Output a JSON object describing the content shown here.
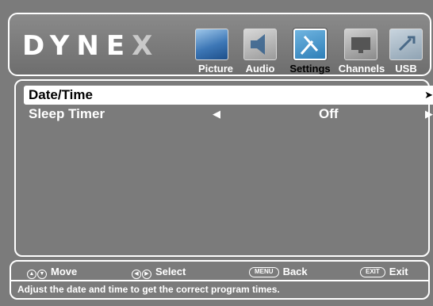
{
  "brand": {
    "logo_main": "DYNE",
    "logo_last": "X"
  },
  "tabs": [
    {
      "label": "Picture",
      "icon": "picture-icon",
      "active": false
    },
    {
      "label": "Audio",
      "icon": "audio-icon",
      "active": false
    },
    {
      "label": "Settings",
      "icon": "settings-icon",
      "active": true
    },
    {
      "label": "Channels",
      "icon": "channels-icon",
      "active": false
    },
    {
      "label": "USB",
      "icon": "usb-icon",
      "active": false
    }
  ],
  "menu": {
    "items": [
      {
        "label": "Date/Time",
        "value": "",
        "left_arrow": "",
        "right_arrow": "➤",
        "selected": true
      },
      {
        "label": "Sleep Timer",
        "value": "Off",
        "left_arrow": "◀",
        "right_arrow": "▶",
        "selected": false
      }
    ]
  },
  "footer": {
    "hints": [
      {
        "keys": [
          "▲",
          "▼"
        ],
        "label": "Move",
        "icon": "up-down-buttons-icon"
      },
      {
        "keys": [
          "◀",
          "▶"
        ],
        "label": "Select",
        "icon": "left-right-buttons-icon"
      },
      {
        "key": "MENU",
        "label": "Back",
        "icon": "menu-button-icon"
      },
      {
        "key": "EXIT",
        "label": "Exit",
        "icon": "exit-button-icon"
      }
    ],
    "help_text": "Adjust the date and time to get the correct program times."
  },
  "colors": {
    "background": "#7b7b7b",
    "text": "#ffffff",
    "selection": "#ffffff",
    "active_tab_text": "#000000"
  }
}
